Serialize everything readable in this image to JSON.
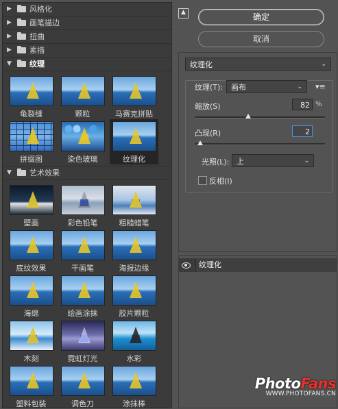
{
  "filter_gallery": {
    "categories_collapsed": [
      "风格化",
      "画笔描边",
      "扭曲",
      "素描"
    ],
    "texture_category": "纹理",
    "texture_items": [
      {
        "label": "龟裂缝",
        "style": "p-sea"
      },
      {
        "label": "颗粒",
        "style": "p-sea"
      },
      {
        "label": "马赛克拼贴",
        "style": "p-sea"
      },
      {
        "label": "拼缀图",
        "style": "p-tile"
      },
      {
        "label": "染色玻璃",
        "style": "p-glass"
      },
      {
        "label": "纹理化",
        "style": "p-sea",
        "selected": true
      }
    ],
    "artistic_category": "艺术效果",
    "artistic_items": [
      {
        "label": "壁画",
        "style": "p-dark"
      },
      {
        "label": "彩色铅笔",
        "style": "p-pencil"
      },
      {
        "label": "粗糙蜡笔",
        "style": "p-rough"
      },
      {
        "label": "底纹效果",
        "style": "p-sea"
      },
      {
        "label": "干画笔",
        "style": "p-sea"
      },
      {
        "label": "海报边缘",
        "style": "p-sea"
      },
      {
        "label": "海绵",
        "style": "p-sea"
      },
      {
        "label": "绘画涂抹",
        "style": "p-sea"
      },
      {
        "label": "胶片颗粒",
        "style": "p-sea"
      },
      {
        "label": "木刻",
        "style": "p-pale"
      },
      {
        "label": "霓虹灯光",
        "style": "p-neon"
      },
      {
        "label": "水彩",
        "style": "p-water"
      },
      {
        "label": "塑料包装",
        "style": "p-sea"
      },
      {
        "label": "调色刀",
        "style": "p-sea"
      },
      {
        "label": "涂抹棒",
        "style": "p-sea"
      }
    ]
  },
  "buttons": {
    "ok": "确定",
    "cancel": "取消",
    "collapse_icon": "▲"
  },
  "settings": {
    "filter": "纹理化",
    "texture_label": "纹理(T):",
    "texture_value": "画布",
    "scaling_label": "缩放(S)",
    "scaling_value": "82",
    "scaling_unit": "%",
    "scaling_fraction": 0.41,
    "relief_label": "凸现(R)",
    "relief_value": "2",
    "relief_fraction": 0.04,
    "light_label": "光照(L):",
    "light_value": "上",
    "invert_label": "反相(I)",
    "invert_checked": false
  },
  "layers": {
    "items": [
      {
        "name": "纹理化",
        "visible": true
      }
    ]
  },
  "watermark": {
    "brand_main": "Photo",
    "brand_accent": "Fans",
    "url": "WWW.PHOTOFANS.CN"
  }
}
